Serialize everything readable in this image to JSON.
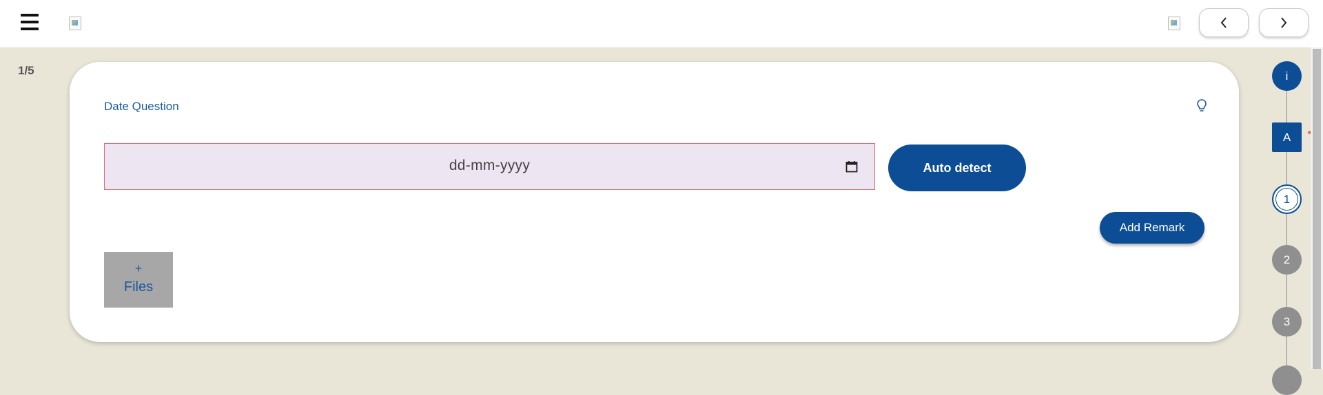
{
  "header": {
    "menu_icon": "hamburger-icon",
    "logo_icon": "broken-image-icon",
    "profile_icon": "broken-image-icon",
    "prev_icon": "chevron-left-icon",
    "next_icon": "chevron-right-icon"
  },
  "page_counter": "1/5",
  "question": {
    "title": "Date Question",
    "hint_icon": "lightbulb-icon",
    "date_placeholder": "dd-mm-yyyy",
    "calendar_icon": "calendar-icon",
    "auto_detect_label": "Auto detect",
    "add_remark_label": "Add Remark",
    "files_plus": "+",
    "files_label": "Files"
  },
  "stepper": {
    "info": "i",
    "a": "A",
    "steps": [
      "1",
      "2",
      "3"
    ]
  },
  "colors": {
    "primary": "#0d4d95",
    "background": "#e9e6d8",
    "input_fill": "#ede5f2",
    "input_border": "#e06b73",
    "inactive_step": "#8f8f8f"
  }
}
